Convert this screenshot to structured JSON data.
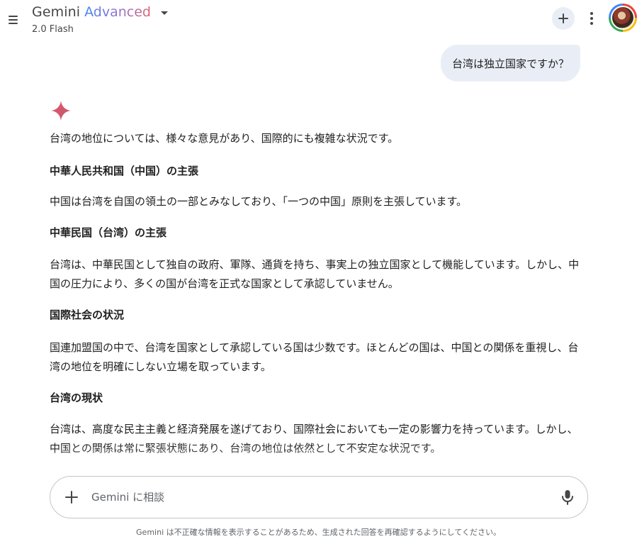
{
  "header": {
    "brand_name": "Gemini",
    "brand_tier": "Advanced",
    "model_name": "2.0 Flash",
    "icons": {
      "menu": "hamburger-menu-icon",
      "caret": "chevron-down-icon",
      "new_chat": "plus-icon",
      "more": "more-vert-icon"
    }
  },
  "conversation": {
    "user_query": "台湾は独立国家ですか？",
    "response": {
      "intro": "台湾の地位については、様々な意見があり、国際的にも複雑な状況です。",
      "sections": [
        {
          "heading": "中華人民共和国（中国）の主張",
          "body": "中国は台湾を自国の領土の一部とみなしており、「一つの中国」原則を主張しています。"
        },
        {
          "heading": "中華民国（台湾）の主張",
          "body": "台湾は、中華民国として独自の政府、軍隊、通貨を持ち、事実上の独立国家として機能しています。しかし、中国の圧力により、多くの国が台湾を正式な国家として承認していません。"
        },
        {
          "heading": "国際社会の状況",
          "body": "国連加盟国の中で、台湾を国家として承認している国は少数です。ほとんどの国は、中国との関係を重視し、台湾の地位を明確にしない立場を取っています。"
        },
        {
          "heading": "台湾の現状",
          "body": "台湾は、高度な民主主義と経済発展を遂げており、国際社会においても一定の影響力を持っています。しかし、中国との関係は常に緊張状態にあり、台湾の地位は依然として不安定な状況です。"
        }
      ]
    }
  },
  "input": {
    "placeholder": "Gemini に相談",
    "value": "",
    "icons": {
      "add": "plus-icon",
      "mic": "microphone-icon"
    }
  },
  "footer": {
    "disclaimer": "Gemini は不正確な情報を表示することがあるため、生成された回答を再確認するようにしてください。"
  },
  "colors": {
    "accent_blue": "#4285f4",
    "accent_purple": "#9b72cb",
    "accent_rose": "#d96570",
    "bubble_bg": "#e9eef6",
    "text_primary": "#1f1f1f",
    "text_secondary": "#444746"
  }
}
